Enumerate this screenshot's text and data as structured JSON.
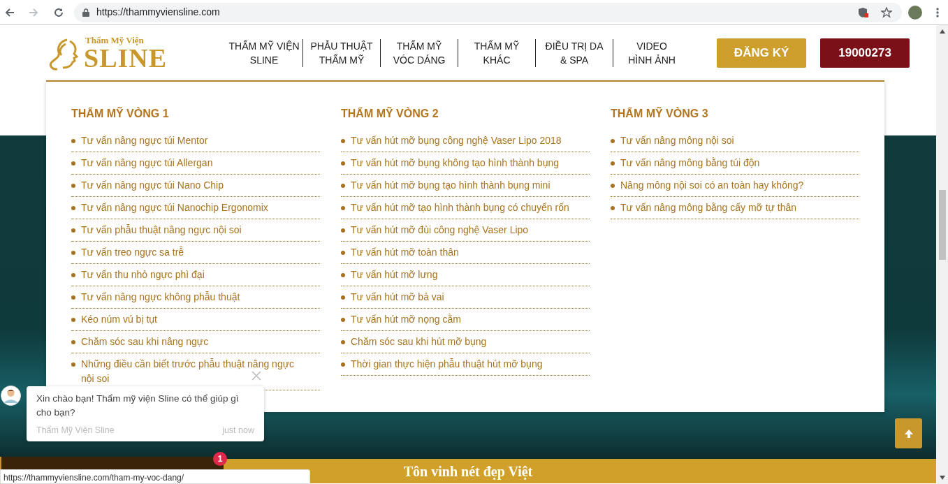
{
  "browser": {
    "url": "https://thammyviensline.com",
    "forward_disabled": true,
    "status_url": "https://thammyviensline.com/tham-my-voc-dang/"
  },
  "logo": {
    "tagline": "Thẩm Mỹ Viện",
    "name": "SLINE"
  },
  "nav": [
    {
      "lines": [
        "THẨM MỸ VIỆN",
        "SLINE"
      ]
    },
    {
      "lines": [
        "PHẪU THUẬT",
        "THẨM MỸ"
      ]
    },
    {
      "lines": [
        "THẨM MỸ",
        "VÓC DÁNG"
      ]
    },
    {
      "lines": [
        "THẨM MỸ",
        "KHÁC"
      ]
    },
    {
      "lines": [
        "ĐIỀU TRỊ DA",
        "& SPA"
      ]
    },
    {
      "lines": [
        "VIDEO",
        "HÌNH ẢNH"
      ]
    }
  ],
  "header_buttons": [
    {
      "kind": "register",
      "label": "ĐĂNG KÝ"
    },
    {
      "kind": "phone",
      "label": "19000273"
    }
  ],
  "menu": [
    {
      "title": "THẨM MỸ VÒNG 1",
      "items": [
        "Tư vấn nâng ngực túi Mentor",
        "Tư vấn nâng ngực túi Allergan",
        "Tư vấn nâng ngực túi Nano Chip",
        "Tư vấn nâng ngực túi Nanochip Ergonomix",
        "Tư vấn phẫu thuật nâng ngực nội soi",
        "Tư vấn treo ngực sa trễ",
        "Tư vấn thu nhỏ ngực phì đại",
        "Tư vấn nâng ngực không phẫu thuật",
        "Kéo núm vú bị tụt",
        "Chăm sóc sau khi nâng ngực",
        "Những điều cần biết trước phẫu thuật nâng ngực nội soi"
      ]
    },
    {
      "title": "THẨM MỸ VÒNG 2",
      "items": [
        "Tư vấn hút mỡ bụng công nghệ Vaser Lipo 2018",
        "Tư vấn hút mỡ bụng không tạo hình thành bụng",
        "Tư vấn hút mỡ bụng tạo hình thành bụng mini",
        "Tư vấn hút mỡ tạo hình thành bụng có chuyển rốn",
        "Tư vấn hút mỡ đùi công nghệ Vaser Lipo",
        "Tư vấn hút mỡ toàn thân",
        "Tư vấn hút mỡ lưng",
        "Tư vấn hút mỡ bả vai",
        "Tư vấn hút mỡ nọng cằm",
        "Chăm sóc sau khi hút mỡ bụng",
        "Thời gian thực hiện phẫu thuật hút mỡ bụng"
      ]
    },
    {
      "title": "THẨM MỸ VÒNG 3",
      "items": [
        "Tư vấn nâng mông nội soi",
        "Tư vấn nâng mông bằng túi độn",
        "Nâng mông nội soi có an toàn hay không?",
        "Tư vấn nâng mông bằng cấy mỡ tự thân"
      ]
    }
  ],
  "chat": {
    "message": "Xin chào bạn! Thẩm mỹ viện Sline có thể giúp gì cho bạn?",
    "sender": "Thẩm Mỹ Viện Sline",
    "time": "just now",
    "badge": "1"
  },
  "banner": {
    "text": "Tôn vinh nét đẹp Việt"
  }
}
